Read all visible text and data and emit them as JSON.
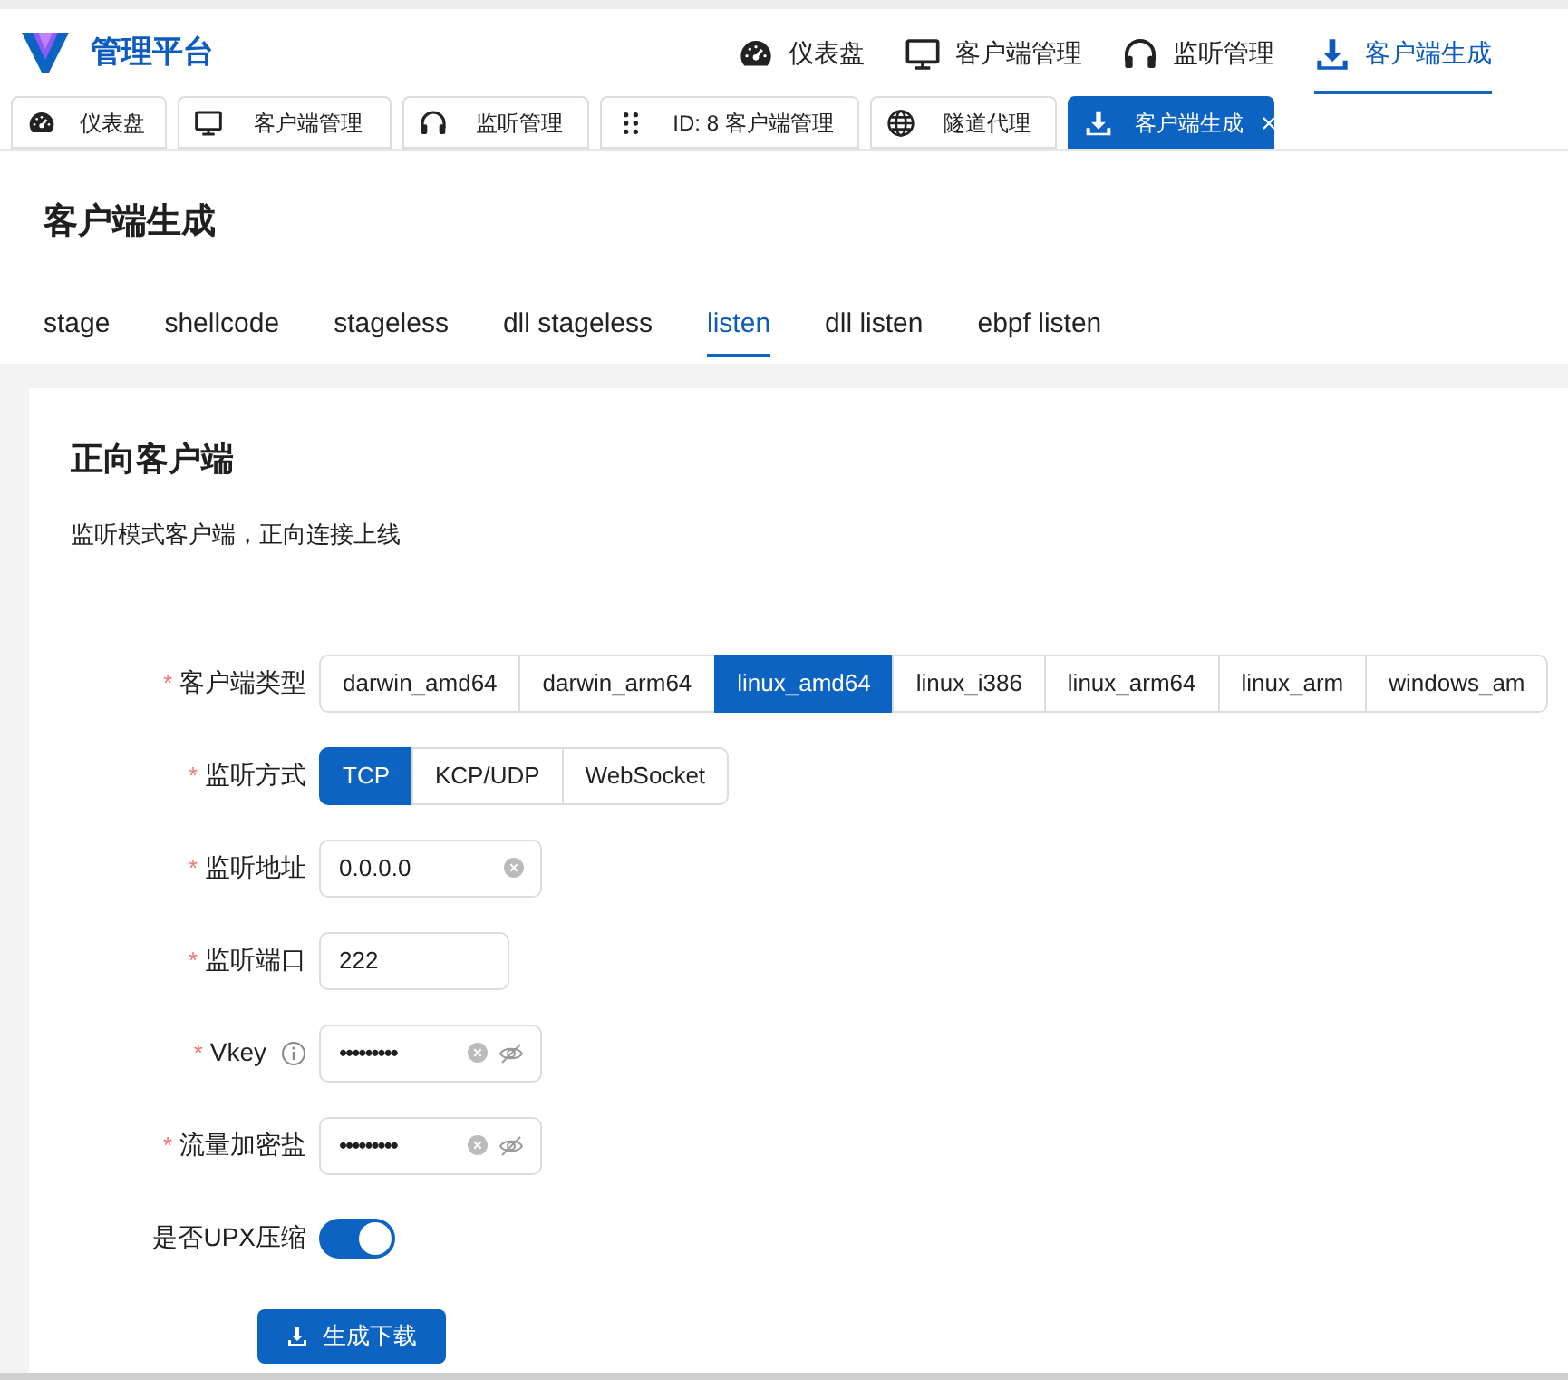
{
  "app": {
    "title": "管理平台"
  },
  "top_nav": [
    {
      "kind": "gauge",
      "label": "仪表盘",
      "selected": false
    },
    {
      "kind": "monitor",
      "label": "客户端管理",
      "selected": false
    },
    {
      "kind": "headphones",
      "label": "监听管理",
      "selected": false
    },
    {
      "kind": "download",
      "label": "客户端生成",
      "selected": true
    }
  ],
  "open_tabs": [
    {
      "kind": "gauge",
      "label": "仪表盘",
      "selected": false
    },
    {
      "kind": "monitor",
      "label": "客户端管理",
      "selected": false
    },
    {
      "kind": "headphones",
      "label": "监听管理",
      "selected": false
    },
    {
      "kind": "dots",
      "label": "ID: 8 客户端管理",
      "selected": false
    },
    {
      "kind": "globe",
      "label": "隧道代理",
      "selected": false
    },
    {
      "kind": "download",
      "label": "客户端生成",
      "selected": true,
      "closable": true
    }
  ],
  "page_title": "客户端生成",
  "sub_tabs": [
    {
      "label": "stage",
      "selected": false
    },
    {
      "label": "shellcode",
      "selected": false
    },
    {
      "label": "stageless",
      "selected": false
    },
    {
      "label": "dll stageless",
      "selected": false
    },
    {
      "label": "listen",
      "selected": true
    },
    {
      "label": "dll listen",
      "selected": false
    },
    {
      "label": "ebpf listen",
      "selected": false
    }
  ],
  "card": {
    "title": "正向客户端",
    "description": "监听模式客户端，正向连接上线"
  },
  "form": [
    {
      "kind": "segmented",
      "label": "客户端类型",
      "required_mark": "*",
      "options": [
        {
          "label": "darwin_amd64",
          "selected": false
        },
        {
          "label": "darwin_arm64",
          "selected": false
        },
        {
          "label": "linux_amd64",
          "selected": true
        },
        {
          "label": "linux_i386",
          "selected": false
        },
        {
          "label": "linux_arm64",
          "selected": false
        },
        {
          "label": "linux_arm",
          "selected": false
        },
        {
          "label": "windows_am",
          "selected": false
        }
      ]
    },
    {
      "kind": "segmented",
      "label": "监听方式",
      "required_mark": "*",
      "options": [
        {
          "label": "TCP",
          "selected": true
        },
        {
          "label": "KCP/UDP",
          "selected": false
        },
        {
          "label": "WebSocket",
          "selected": false
        }
      ]
    },
    {
      "kind": "text",
      "label": "监听地址",
      "required_mark": "*",
      "value": "0.0.0.0",
      "clearable": true
    },
    {
      "kind": "text",
      "label": "监听端口",
      "required_mark": "*",
      "value": "222",
      "clearable": false
    },
    {
      "kind": "password",
      "label": "Vkey",
      "required_mark": "*",
      "info": true,
      "value": "•••••••••",
      "clearable": true
    },
    {
      "kind": "password",
      "label": "流量加密盐",
      "required_mark": "*",
      "value": "•••••••••",
      "clearable": true
    },
    {
      "kind": "switch",
      "label": "是否UPX压缩",
      "on": true
    }
  ],
  "submit": {
    "label": "生成下载"
  }
}
